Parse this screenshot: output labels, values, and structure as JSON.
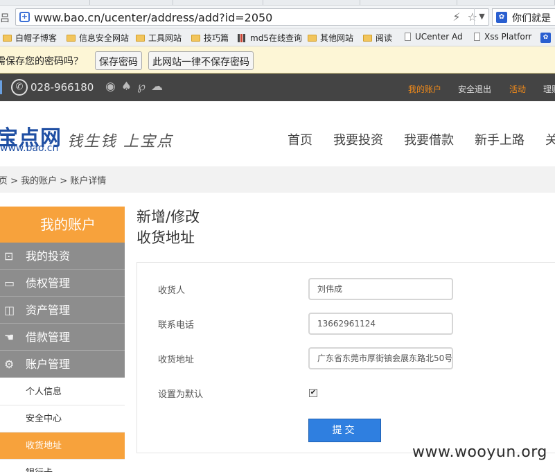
{
  "browser": {
    "url": "www.bao.cn/ucenter/address/add?id=2050",
    "url_prefix_char": "吕",
    "search_text": "你们就是",
    "bookmarks": [
      {
        "label": "白帽子博客",
        "icon": "folder"
      },
      {
        "label": "信息安全网站",
        "icon": "folder"
      },
      {
        "label": "工具网站",
        "icon": "folder"
      },
      {
        "label": "技巧篇",
        "icon": "folder"
      },
      {
        "label": "md5在线查询",
        "icon": "grid"
      },
      {
        "label": "其他网站",
        "icon": "folder"
      },
      {
        "label": "阅读",
        "icon": "folder"
      },
      {
        "label": "UCenter Ad",
        "icon": "page"
      },
      {
        "label": "Xss Platforr",
        "icon": "page"
      }
    ],
    "password_prompt": {
      "question": "需保存您的密码吗？",
      "save_label": "保存密码",
      "never_label": "此网站一律不保存密码"
    }
  },
  "site": {
    "phone": "028-966180",
    "top_links": [
      {
        "label": "我的账户",
        "highlight": true
      },
      {
        "label": "安全退出",
        "highlight": false
      },
      {
        "label": "活动",
        "highlight": true
      },
      {
        "label": "理财",
        "highlight": false
      }
    ],
    "logo_text": "宝点网",
    "logo_url": "www.bao.cn",
    "slogan": "钱生钱 上宝点",
    "main_nav": [
      "首页",
      "我要投资",
      "我要借款",
      "新手上路",
      "关"
    ],
    "breadcrumb": "页 > 我的账户 > 账户详情"
  },
  "sidebar": {
    "title": "我的账户",
    "menus": [
      {
        "label": "我的投资",
        "icon": "plug-icon"
      },
      {
        "label": "债权管理",
        "icon": "card-icon"
      },
      {
        "label": "资产管理",
        "icon": "folder-icon"
      },
      {
        "label": "借款管理",
        "icon": "hand-icon"
      },
      {
        "label": "账户管理",
        "icon": "gear-icon"
      }
    ],
    "subitems": [
      {
        "label": "个人信息",
        "active": false
      },
      {
        "label": "安全中心",
        "active": false
      },
      {
        "label": "收货地址",
        "active": true
      },
      {
        "label": "银行卡",
        "active": false
      }
    ]
  },
  "form": {
    "title_line1": "新增/修改",
    "title_line2": "收货地址",
    "fields": [
      {
        "label": "收货人",
        "value": "刘伟成"
      },
      {
        "label": "联系电话",
        "value": "13662961124"
      },
      {
        "label": "收货地址",
        "value": "广东省东莞市厚街镇会展东路北50号"
      }
    ],
    "default_label": "设置为默认",
    "default_checked": true,
    "submit_label": "提交"
  },
  "watermark": "www.wooyun.org",
  "colors": {
    "accent_orange": "#f7a23c",
    "dark_bar": "#444444",
    "sidebar_gray": "#8d8d8d",
    "submit_blue": "#2f7fe0",
    "logo_blue": "#1f4fa3"
  }
}
